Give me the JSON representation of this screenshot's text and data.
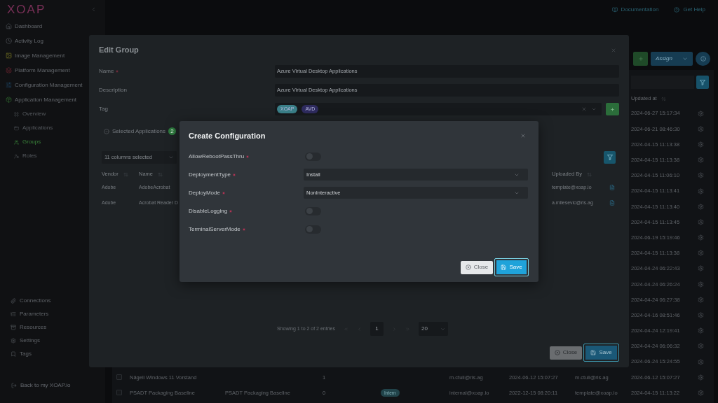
{
  "sidebar": {
    "logo": "XOAP",
    "nav": [
      {
        "label": "Dashboard",
        "selected": false
      },
      {
        "label": "Activity Log",
        "selected": false
      },
      {
        "label": "Image Management",
        "selected": false
      },
      {
        "label": "Platform Management",
        "selected": false
      },
      {
        "label": "Configuration Management",
        "selected": false
      },
      {
        "label": "Application Management",
        "selected": false,
        "children": [
          {
            "label": "Overview",
            "selected": false
          },
          {
            "label": "Applications",
            "selected": false
          },
          {
            "label": "Groups",
            "selected": true
          },
          {
            "label": "Roles",
            "selected": false
          }
        ]
      }
    ],
    "footer_nav": [
      {
        "label": "Connections",
        "selected": false
      },
      {
        "label": "Parameters",
        "selected": false
      },
      {
        "label": "Resources",
        "selected": false
      },
      {
        "label": "Settings",
        "selected": false
      },
      {
        "label": "Tags",
        "selected": false
      }
    ],
    "back_link": "Back to my XOAP.io"
  },
  "top_bar": {
    "links": [
      "Documentation",
      "Get Help"
    ]
  },
  "toolbar": {
    "assign_button": "Assign"
  },
  "table": {
    "columns": [
      {
        "label": "Updated at"
      }
    ],
    "rows": [
      {
        "updated_at": "2024-06-27 15:17:34"
      },
      {
        "updated_at": "2024-06-21 08:46:30"
      },
      {
        "updated_at": "2024-04-15 11:13:38"
      },
      {
        "updated_at": "2024-04-15 11:13:38"
      },
      {
        "updated_at": "2024-04-15 11:06:10"
      },
      {
        "updated_at": "2024-04-15 11:13:41"
      },
      {
        "updated_at": "2024-04-15 11:13:40"
      },
      {
        "updated_at": "2024-04-15 11:13:45"
      },
      {
        "updated_at": "2024-06-19 15:19:46"
      },
      {
        "updated_at": "2024-04-15 11:13:38"
      },
      {
        "updated_at": "2024-04-24 06:22:43"
      },
      {
        "updated_at": "2024-04-24 06:26:24"
      },
      {
        "updated_at": "2024-04-24 06:27:38"
      },
      {
        "updated_at": "2024-04-16 08:51:46"
      },
      {
        "updated_at": "2024-04-24 12:19:41"
      },
      {
        "updated_at": "2024-04-24 06:06:32"
      },
      {
        "updated_at": "2024-06-24 15:24:55"
      },
      {
        "checked": false,
        "column_2": "Nägeli Windows 11 Vorstand",
        "column_4": "1",
        "column_6": "m.ctuli@ris.ag",
        "column_7": "2024-06-12 15:07:27",
        "column_8": "m.ctuli@ris.ag",
        "updated_at": "2024-06-12 15:07:27"
      },
      {
        "checked": false,
        "column_2": "PSADT Packaging Baseline",
        "column_3": "PSADT Packaging Baseline",
        "column_4": "0",
        "column_5": "Intern",
        "column_6": "internal@xoap.io",
        "column_7": "2022-12-15 08:20:11",
        "column_8": "template@xoap.io",
        "updated_at": "2024-04-15 11:13:22"
      }
    ]
  },
  "edit_group": {
    "title": "Edit Group",
    "fields": [
      {
        "label": "Name",
        "required": true,
        "kind": "text",
        "value": "Azure Virtual Desktop Applications"
      },
      {
        "label": "Description",
        "required": false,
        "kind": "text",
        "value": "Azure Virtual Desktop Applications"
      },
      {
        "label": "Tag",
        "required": false,
        "kind": "tags",
        "tags": [
          {
            "label": "XOAP",
            "color": "#3a7f88"
          },
          {
            "label": "AVD",
            "color": "#2e2b5e"
          }
        ]
      }
    ],
    "tabs": [
      {
        "label": "Selected Applications",
        "count": "2",
        "selected": true
      }
    ],
    "column_picker": "11 columns selected",
    "table": {
      "columns": [
        {
          "label": "Vendor"
        },
        {
          "label": "Name"
        },
        {
          "label": "Uploaded By"
        }
      ],
      "rows": [
        {
          "cells": [
            "Adobe",
            "AdobeAcrobat",
            "template@xoap.io"
          ]
        },
        {
          "cells": [
            "Adobe",
            "Acrobat Reader D",
            "a.milesevic@ris.ag"
          ]
        }
      ]
    },
    "pagination": {
      "summary": "Showing 1 to 2 of 2 entries",
      "pages": [
        {
          "label": "1",
          "selected": true
        }
      ],
      "page_size": "20"
    },
    "buttons": [
      {
        "label": "Close",
        "kind": "secondary",
        "focused": false
      },
      {
        "label": "Save",
        "kind": "primary",
        "focused": true
      }
    ]
  },
  "create_configuration": {
    "title": "Create Configuration",
    "fields": [
      {
        "label": "AllowRebootPassThru",
        "required": true,
        "kind": "toggle",
        "on": false
      },
      {
        "label": "DeploymentType",
        "required": true,
        "kind": "select",
        "value": "Install"
      },
      {
        "label": "DeployMode",
        "required": true,
        "kind": "select",
        "value": "NonInteractive"
      },
      {
        "label": "DisableLogging",
        "required": true,
        "kind": "toggle",
        "on": false
      },
      {
        "label": "TerminalServerMode",
        "required": true,
        "kind": "toggle",
        "on": false
      }
    ],
    "buttons": [
      {
        "label": "Close",
        "kind": "secondary",
        "focused": false
      },
      {
        "label": "Save",
        "kind": "primary",
        "focused": true
      }
    ]
  }
}
